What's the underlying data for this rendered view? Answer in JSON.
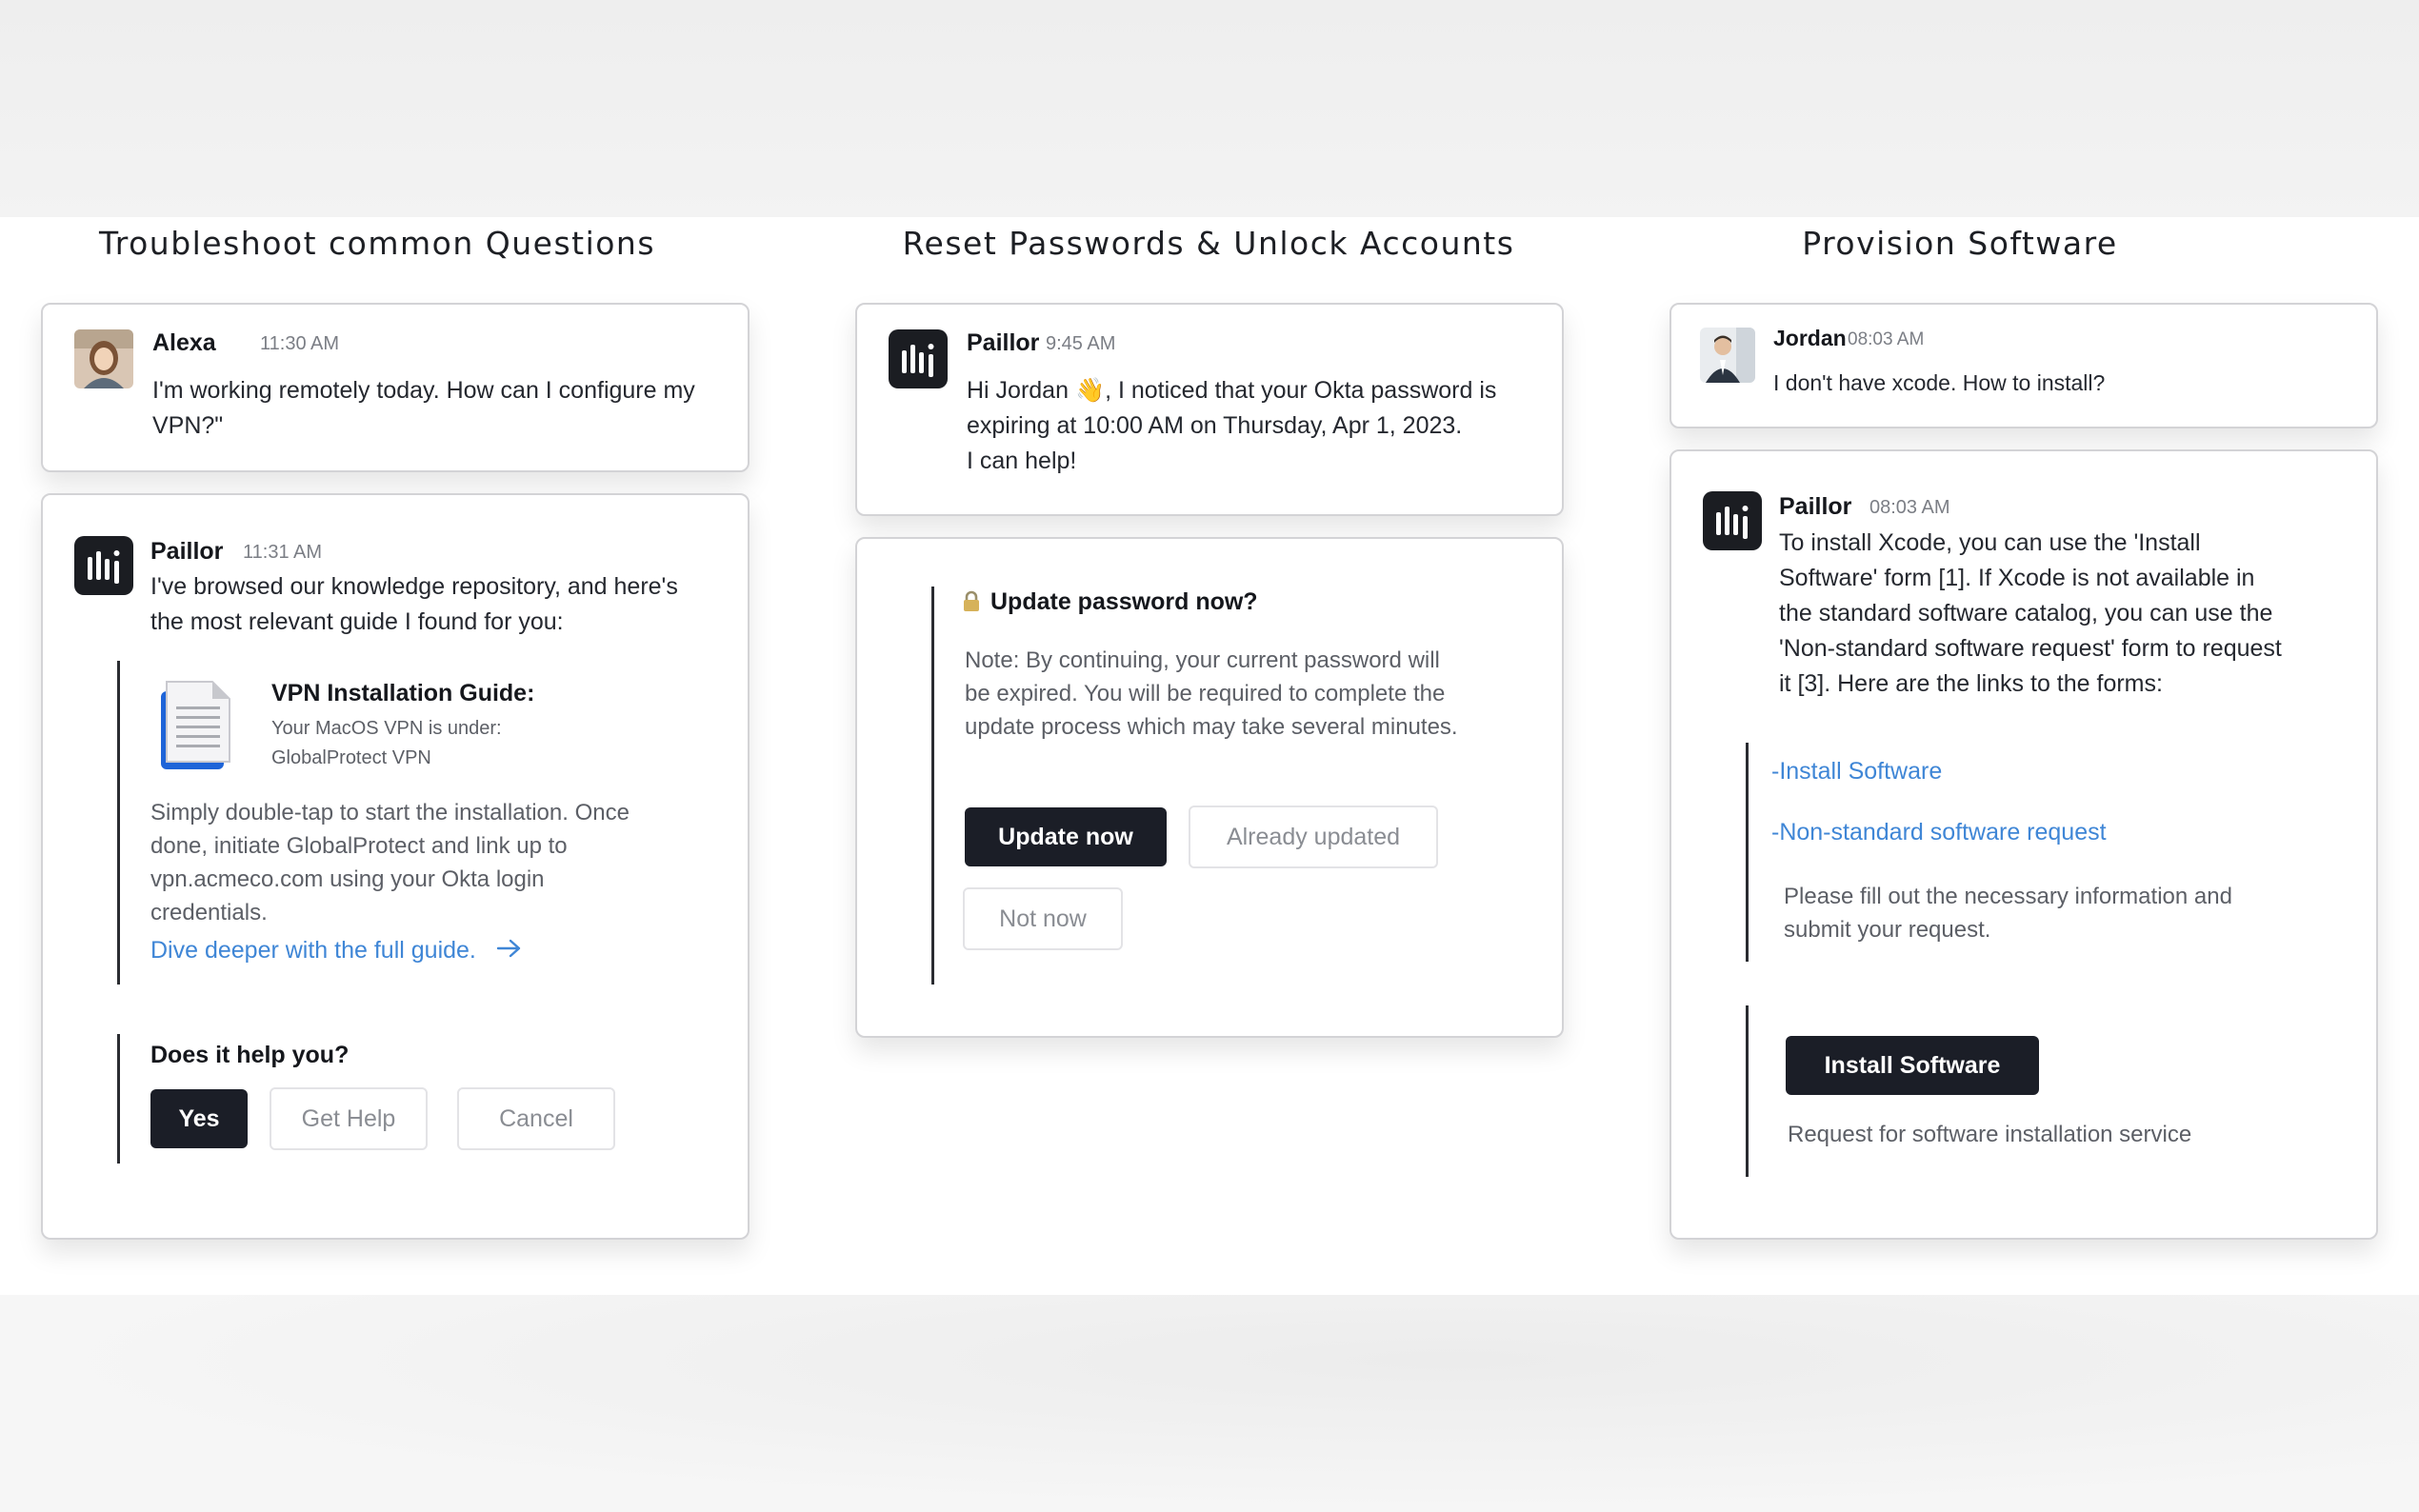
{
  "columns": [
    {
      "title": "Troubleshoot common Questions"
    },
    {
      "title": "Reset Passwords & Unlock Accounts"
    },
    {
      "title": "Provision Software"
    }
  ],
  "troubleshoot": {
    "user_message": {
      "name": "Alexa",
      "time": "11:30 AM",
      "text": "I'm working remotely today. How can I configure my VPN?\""
    },
    "bot_message": {
      "name": "Paillor",
      "time": "11:31 AM",
      "text": "I've browsed our knowledge repository, and here's the most relevant guide I found for you:",
      "guide_title": "VPN Installation Guide:",
      "guide_desc": "Your MacOS VPN is under: GlobalProtect VPN",
      "instructions": "Simply double-tap to start the installation. Once done, initiate GlobalProtect and link up to vpn.acmeco.com using your Okta login credentials.",
      "link_label": "Dive deeper with the full guide.",
      "question": "Does it help you?",
      "buttons": {
        "yes": "Yes",
        "get_help": "Get Help",
        "cancel": "Cancel"
      }
    }
  },
  "reset": {
    "bot_message": {
      "name": "Paillor",
      "time": "9:45 AM",
      "text_prefix": "Hi Jordan",
      "emoji": "👋",
      "text_main": ", I noticed that your Okta password is expiring at 10:00 AM on Thursday, Apr 1, 2023.",
      "text_tail": "I can help!"
    },
    "prompt": {
      "title": "Update password now?",
      "note": "Note: By continuing, your current password will be expired. You will be required to complete the update process which may take several minutes.",
      "buttons": {
        "update_now": "Update now",
        "already_updated": "Already updated",
        "not_now": "Not now"
      }
    }
  },
  "provision": {
    "user_message": {
      "name": "Jordan",
      "time": "08:03 AM",
      "text": "I don't have xcode. How to install?"
    },
    "bot_message": {
      "name": "Paillor",
      "time": "08:03 AM",
      "text": "To install Xcode, you can use the 'Install Software' form [1]. If Xcode is not available in the standard software catalog, you can use the 'Non-standard software request' form to request it [3]. Here are the links to the forms:",
      "link_install": "-Install Software",
      "link_nonstandard": "-Non-standard software request",
      "fill_note": "Please fill out the necessary information and submit your request.",
      "install_button": "Install Software",
      "service_note": "Request for software installation service"
    }
  },
  "colors": {
    "dark_button": "#1b1e27",
    "link_blue": "#3f86d6",
    "card_border": "#d3d3d6"
  }
}
